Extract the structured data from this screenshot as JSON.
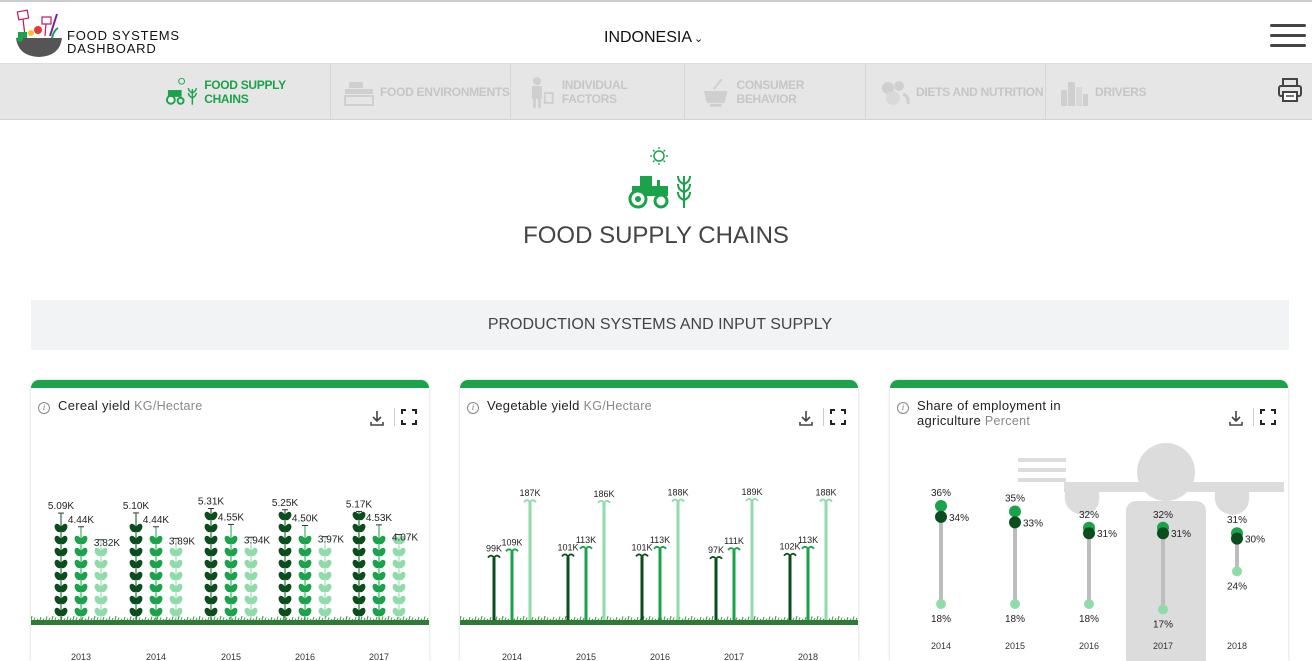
{
  "header": {
    "logo_text_line1": "FOOD SYSTEMS",
    "logo_text_line2": "DASHBOARD",
    "country": "INDONESIA",
    "menu_icon": "hamburger-menu-icon"
  },
  "nav": {
    "items": [
      {
        "label": "FOOD SUPPLY CHAINS",
        "icon": "tractor-icon",
        "active": true
      },
      {
        "label": "FOOD ENVIRONMENTS",
        "icon": "market-stall-icon",
        "active": false
      },
      {
        "label": "INDIVIDUAL FACTORS",
        "icon": "person-icon",
        "active": false
      },
      {
        "label": "CONSUMER BEHAVIOR",
        "icon": "cooking-pot-icon",
        "active": false
      },
      {
        "label": "DIETS AND NUTRITION",
        "icon": "produce-icon",
        "active": false
      },
      {
        "label": "DRIVERS",
        "icon": "city-icon",
        "active": false
      }
    ],
    "print_icon": "printer-icon"
  },
  "page": {
    "title": "FOOD SUPPLY CHAINS",
    "section_title": "PRODUCTION SYSTEMS AND INPUT SUPPLY"
  },
  "cards": [
    {
      "title": "Cereal yield",
      "unit": "KG/Hectare"
    },
    {
      "title": "Vegetable yield",
      "unit": "KG/Hectare"
    },
    {
      "title": "Share of employment in agriculture",
      "unit": "Percent"
    }
  ],
  "colors": {
    "accent": "#1aa34a",
    "dark_green": "#0b4d1c",
    "mid_green": "#1aa34a",
    "light_green": "#8fdcaa"
  },
  "chart_data": [
    {
      "type": "bar",
      "title": "Cereal yield",
      "ylabel": "KG/Hectare",
      "categories": [
        "2013",
        "2014",
        "2015",
        "2016",
        "2017"
      ],
      "labels": [
        [
          "5.09K",
          "4.44K",
          "3.82K"
        ],
        [
          "5.10K",
          "4.44K",
          "3.89K"
        ],
        [
          "5.31K",
          "4.55K",
          "3.94K"
        ],
        [
          "5.25K",
          "4.50K",
          "3.97K"
        ],
        [
          "5.17K",
          "4.53K",
          "4.07K"
        ]
      ],
      "series": [
        {
          "values": [
            5090,
            5100,
            5310,
            5250,
            5170
          ]
        },
        {
          "values": [
            4440,
            4440,
            4550,
            4500,
            4530
          ]
        },
        {
          "values": [
            3820,
            3890,
            3940,
            3970,
            4070
          ]
        }
      ]
    },
    {
      "type": "bar",
      "title": "Vegetable yield",
      "ylabel": "KG/Hectare",
      "categories": [
        "2014",
        "2015",
        "2016",
        "2017",
        "2018"
      ],
      "labels": [
        [
          "99K",
          "109K",
          "187K"
        ],
        [
          "101K",
          "113K",
          "186K"
        ],
        [
          "101K",
          "113K",
          "188K"
        ],
        [
          "97K",
          "111K",
          "189K"
        ],
        [
          "102K",
          "113K",
          "188K"
        ]
      ],
      "series": [
        {
          "values": [
            99000,
            101000,
            101000,
            97000,
            102000
          ]
        },
        {
          "values": [
            109000,
            113000,
            113000,
            111000,
            113000
          ]
        },
        {
          "values": [
            187000,
            186000,
            188000,
            189000,
            188000
          ]
        }
      ]
    },
    {
      "type": "scatter",
      "title": "Share of employment in agriculture",
      "ylabel": "Percent",
      "categories": [
        "2014",
        "2015",
        "2016",
        "2017",
        "2018"
      ],
      "labels": [
        [
          "36%",
          "34%",
          "18%"
        ],
        [
          "35%",
          "33%",
          "18%"
        ],
        [
          "32%",
          "31%",
          "18%"
        ],
        [
          "32%",
          "31%",
          "17%"
        ],
        [
          "31%",
          "30%",
          "24%"
        ]
      ],
      "series": [
        {
          "values": [
            36,
            35,
            32,
            32,
            31
          ]
        },
        {
          "values": [
            34,
            33,
            31,
            31,
            30
          ]
        },
        {
          "values": [
            18,
            18,
            18,
            17,
            24
          ]
        }
      ]
    }
  ]
}
